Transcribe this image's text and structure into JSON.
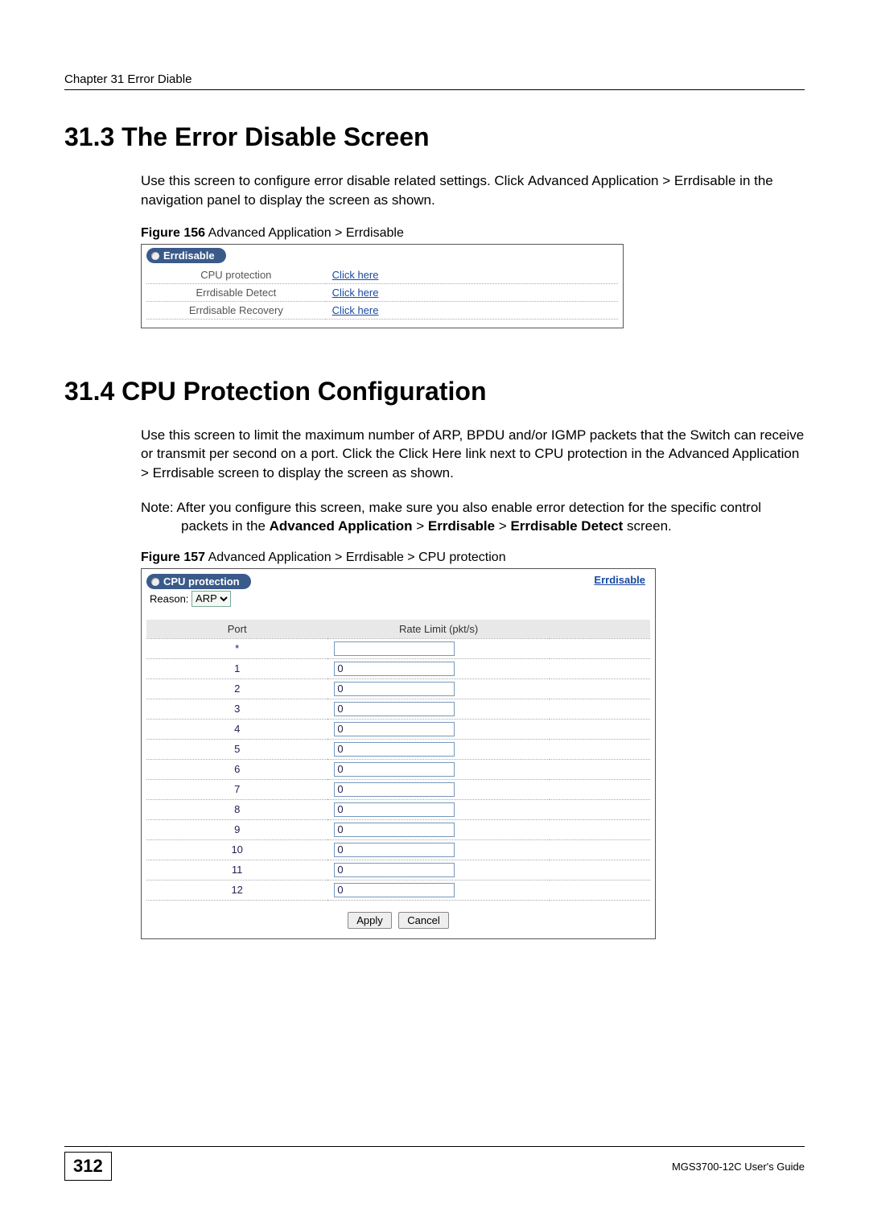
{
  "header": {
    "chapter_line": "Chapter 31 Error Diable"
  },
  "section_313": {
    "title": "31.3  The Error Disable Screen",
    "paragraph_pre": "Use this screen to configure error disable related settings. Click ",
    "nav1": "Advanced Application",
    "sep": " > ",
    "nav2": "Errdisable",
    "paragraph_post": " in the navigation panel to display the screen as shown."
  },
  "figure_156": {
    "caption_bold": "Figure 156",
    "caption_rest": "   Advanced Application > Errdisable",
    "tab_title": "Errdisable",
    "rows": [
      {
        "label": "CPU protection",
        "link": "Click here"
      },
      {
        "label": "Errdisable Detect",
        "link": "Click here"
      },
      {
        "label": "Errdisable Recovery",
        "link": "Click here"
      }
    ]
  },
  "section_314": {
    "title": "31.4  CPU Protection Configuration",
    "para_pre": "Use this screen to limit the maximum number of ARP, BPDU and/or IGMP packets that the Switch can receive or transmit per second on a port. Click the ",
    "click_here": "Click Here",
    "para_mid1": " link next to CPU ",
    "protection": "protection",
    "para_mid2": " in the ",
    "nav1": "Advanced Application",
    "sep": " > ",
    "nav2": "Errdisable",
    "para_post": " screen to display the screen as shown.",
    "note_pre": "Note: After you configure this screen, make sure you also enable error detection for the specific control packets in the ",
    "bold1": "Advanced Application",
    "gt1": " > ",
    "bold2": "Errdisable",
    "gt2": " > ",
    "bold3": "Errdisable Detect",
    "note_post": " screen."
  },
  "figure_157": {
    "caption_bold": "Figure 157",
    "caption_rest": "   Advanced Application > Errdisable > CPU protection",
    "tab_title": "CPU protection",
    "errdisable_link": "Errdisable",
    "reason_label": "Reason:",
    "reason_options": [
      "ARP"
    ],
    "col_port": "Port",
    "col_rate": "Rate Limit (pkt/s)",
    "rows": [
      {
        "port": "*",
        "value": ""
      },
      {
        "port": "1",
        "value": "0"
      },
      {
        "port": "2",
        "value": "0"
      },
      {
        "port": "3",
        "value": "0"
      },
      {
        "port": "4",
        "value": "0"
      },
      {
        "port": "5",
        "value": "0"
      },
      {
        "port": "6",
        "value": "0"
      },
      {
        "port": "7",
        "value": "0"
      },
      {
        "port": "8",
        "value": "0"
      },
      {
        "port": "9",
        "value": "0"
      },
      {
        "port": "10",
        "value": "0"
      },
      {
        "port": "11",
        "value": "0"
      },
      {
        "port": "12",
        "value": "0"
      }
    ],
    "apply": "Apply",
    "cancel": "Cancel"
  },
  "footer": {
    "page": "312",
    "guide": "MGS3700-12C User's Guide"
  }
}
